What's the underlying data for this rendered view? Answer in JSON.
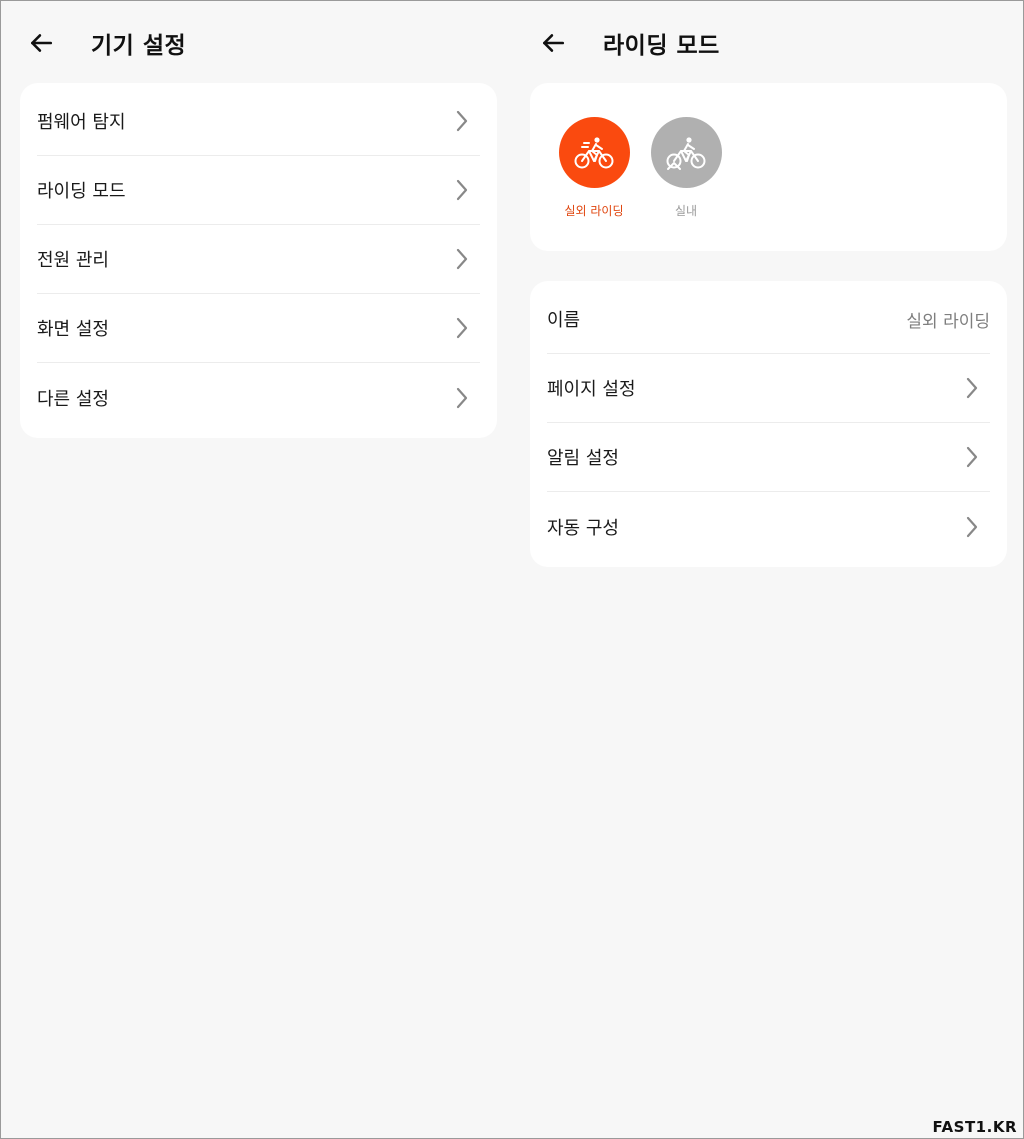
{
  "left_panel": {
    "title": "기기 설정",
    "items": [
      {
        "label": "펌웨어 탐지"
      },
      {
        "label": "라이딩 모드"
      },
      {
        "label": "전원 관리"
      },
      {
        "label": "화면 설정"
      },
      {
        "label": "다른 설정"
      }
    ]
  },
  "right_panel": {
    "title": "라이딩 모드",
    "modes": [
      {
        "label": "실외 라이딩",
        "selected": true,
        "color": "#fa4a0f",
        "icon": "outdoor-bike-icon"
      },
      {
        "label": "실내",
        "selected": false,
        "color": "#b0b0b0",
        "icon": "indoor-bike-icon"
      }
    ],
    "settings": {
      "name_label": "이름",
      "name_value": "실외 라이딩",
      "items": [
        {
          "label": "페이지 설정"
        },
        {
          "label": "알림 설정"
        },
        {
          "label": "자동 구성"
        }
      ]
    }
  },
  "colors": {
    "accent": "#fa4a0f",
    "accent_text": "#e0460f",
    "inactive": "#b0b0b0",
    "inactive_text": "#9a9a9a"
  },
  "watermark": "FAST1.KR"
}
